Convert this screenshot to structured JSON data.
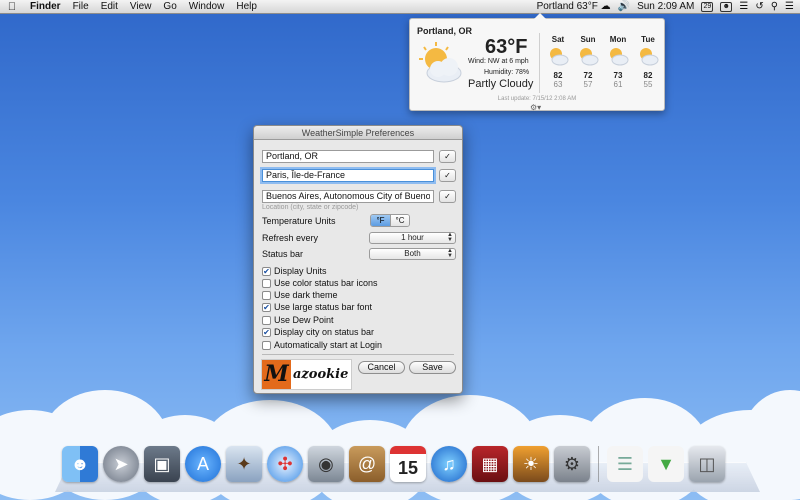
{
  "menubar": {
    "app_name": "Finder",
    "menus": [
      "File",
      "Edit",
      "View",
      "Go",
      "Window",
      "Help"
    ],
    "weather_status": "Portland 63°F",
    "clock": "Sun  2:09 AM",
    "date_badge": "29"
  },
  "weather": {
    "city": "Portland, OR",
    "temperature": "63°F",
    "wind": "Wind: NW at 6 mph",
    "humidity": "Humidity: 78%",
    "condition": "Partly Cloudy",
    "last_update": "Last update: 7/15/12 2:08 AM",
    "forecast": [
      {
        "day": "Sat",
        "high": "82",
        "low": "63"
      },
      {
        "day": "Sun",
        "high": "72",
        "low": "57"
      },
      {
        "day": "Mon",
        "high": "73",
        "low": "61"
      },
      {
        "day": "Tue",
        "high": "82",
        "low": "55"
      }
    ]
  },
  "prefs": {
    "title": "WeatherSimple Preferences",
    "locations": [
      "Portland, OR",
      "Paris, Île-de-France",
      "Buenos Aires, Autonomous City of Buenos"
    ],
    "location_hint": "Location (city, state or zipcode)",
    "check_label": "✓",
    "temp_units_label": "Temperature Units",
    "unit_f": "°F",
    "unit_c": "°C",
    "refresh_label": "Refresh every",
    "refresh_value": "1 hour",
    "status_bar_label": "Status bar",
    "status_bar_value": "Both",
    "options": [
      {
        "label": "Display Units",
        "checked": true
      },
      {
        "label": "Use color status bar icons",
        "checked": false
      },
      {
        "label": "Use dark theme",
        "checked": false
      },
      {
        "label": "Use large status bar font",
        "checked": true
      },
      {
        "label": "Use Dew Point",
        "checked": false
      },
      {
        "label": "Display city on status bar",
        "checked": true
      },
      {
        "label": "Automatically start at Login",
        "checked": false
      }
    ],
    "logo_letter": "M",
    "logo_text": "azookie",
    "cancel_label": "Cancel",
    "save_label": "Save"
  },
  "dock": {
    "icons": [
      "finder-icon",
      "launchpad-icon",
      "mission-control-icon",
      "app-store-icon",
      "mail-icon",
      "safari-icon",
      "facetime-icon",
      "address-book-icon",
      "calendar-icon",
      "itunes-icon",
      "photo-booth-icon",
      "iphoto-icon",
      "system-preferences-icon",
      "documents-stack-icon",
      "downloads-stack-icon",
      "trash-icon"
    ],
    "calendar_day": "15"
  },
  "colors": {
    "accent": "#4a90d9",
    "logo_orange": "#e36a1b",
    "desktop_blue": "#3a72d2"
  }
}
